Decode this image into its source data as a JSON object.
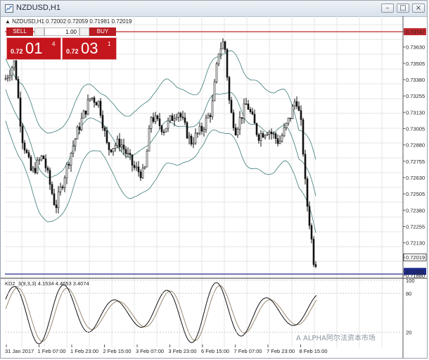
{
  "window": {
    "title": "NZDUSD,H1",
    "min_icon": "minimize-icon",
    "max_icon": "maximize-icon",
    "close_icon": "close-icon"
  },
  "symbol_info": "▲ NZDUSD,H1  0.72002 0.72059 0.71981 0.72019",
  "trade_panel": {
    "sell_label": "SELL",
    "buy_label": "BUY",
    "lot": "1.00",
    "sell_quote": {
      "small": "0.72",
      "big": "01",
      "sup": "4"
    },
    "buy_quote": {
      "small": "0.72",
      "big": "03",
      "sup": "1"
    }
  },
  "price_axis": {
    "labels": [
      "0.73747",
      "0.73630",
      "0.73505",
      "0.73380",
      "0.73255",
      "0.73130",
      "0.73005",
      "0.72880",
      "0.72755",
      "0.72630",
      "0.72505",
      "0.72380",
      "0.72255",
      "0.72130",
      "0.72019",
      "0.71911",
      "0.71880"
    ],
    "current_price": "0.72019",
    "line_price": "0.71911",
    "resistance_price": "0.73747",
    "colors": {
      "resistance": "#c0282d",
      "support": "#1e2a8a"
    }
  },
  "stoch_panel": {
    "label": "KD2_3(9,3,3) 4.1534 4.4653 3.4074",
    "scale": [
      "100",
      "80",
      "20"
    ],
    "colors": {
      "main": "#111111",
      "signal": "#9b8a72"
    }
  },
  "time_axis": [
    "31 Jan 2017",
    "1 Feb 07:00",
    "1 Feb 23:00",
    "2 Feb 15:00",
    "3 Feb 07:00",
    "3 Feb 23:00",
    "6 Feb 15:00",
    "7 Feb 07:00",
    "7 Feb 23:00",
    "8 Feb 15:00"
  ],
  "bands_color": "#3c7a78",
  "watermark": "A ALPHA阿尔法资本市场"
}
